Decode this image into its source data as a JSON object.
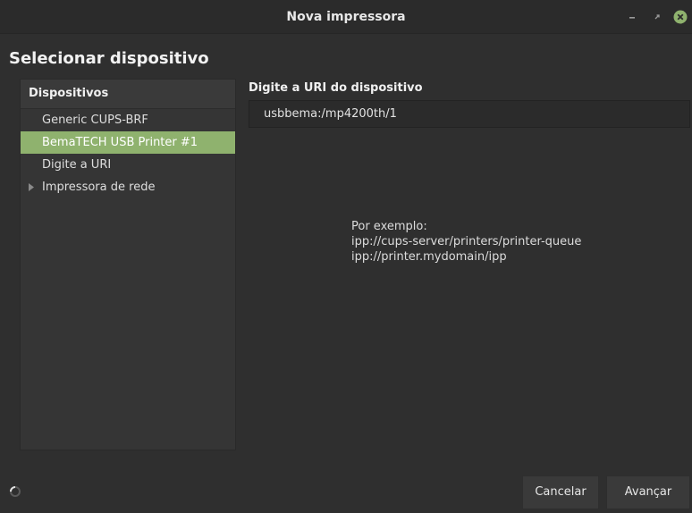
{
  "window": {
    "title": "Nova impressora",
    "controls": {
      "minimize_icon": "minimize-icon",
      "maximize_icon": "maximize-icon",
      "close_icon": "close-icon",
      "close_color": "#8fb26e"
    }
  },
  "page": {
    "heading": "Selecionar dispositivo"
  },
  "devices": {
    "header": "Dispositivos",
    "items": [
      {
        "label": "Generic CUPS-BRF",
        "selected": false,
        "expandable": false
      },
      {
        "label": "BemaTECH USB Printer #1",
        "selected": true,
        "expandable": false
      },
      {
        "label": "Digite a URI",
        "selected": false,
        "expandable": false
      },
      {
        "label": "Impressora de rede",
        "selected": false,
        "expandable": true
      }
    ],
    "selection_color": "#8fb26e"
  },
  "uri": {
    "label": "Digite a URI do dispositivo",
    "value": "usbbema:/mp4200th/1"
  },
  "example": {
    "lines": [
      "Por exemplo:",
      "ipp://cups-server/printers/printer-queue",
      "ipp://printer.mydomain/ipp"
    ]
  },
  "footer": {
    "spinner_icon": "spinner-icon",
    "cancel_label": "Cancelar",
    "next_label": "Avançar"
  }
}
